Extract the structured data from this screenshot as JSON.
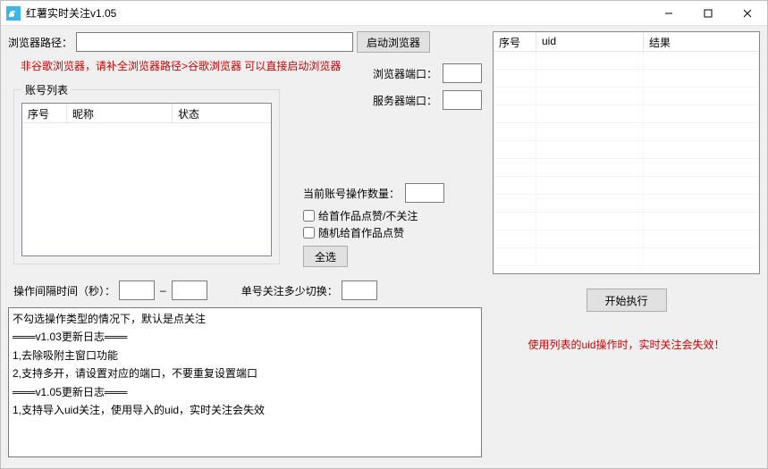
{
  "title": "红薯实时关注v1.05",
  "labels": {
    "browser_path": "浏览器路径：",
    "launch_browser": "启动浏览器",
    "note_red": "非谷歌浏览器，请补全浏览器路径>谷歌浏览器 可以直接启动浏览器",
    "browser_port": "浏览器端口：",
    "server_port": "服务器端口：",
    "account_list_legend": "账号列表",
    "col_seq": "序号",
    "col_nick": "昵称",
    "col_status": "状态",
    "current_account_ops": "当前账号操作数量：",
    "chk_like_unfollow": "给首作品点赞/不关注",
    "chk_random_like": "随机给首作品点赞",
    "select_all": "全选",
    "op_interval": "操作间隔时间（秒）：",
    "dash": "–",
    "single_switch": "单号关注多少切换：",
    "start_exec": "开始执行",
    "warn_red": "使用列表的uid操作时，实时关注会失效！",
    "right_col_seq": "序号",
    "right_col_uid": "uid",
    "right_col_result": "结果"
  },
  "values": {
    "browser_path": "",
    "browser_port": "",
    "server_port": "",
    "current_account_ops": "",
    "interval_min": "",
    "interval_max": "",
    "single_switch": ""
  },
  "log_text": "不勾选操作类型的情况下，默认是点关注\n═══v1.03更新日志═══\n1,去除吸附主窗口功能\n2,支持多开，请设置对应的端口，不要重复设置端口\n═══v1.05更新日志═══\n1,支持导入uid关注，使用导入的uid，实时关注会失效"
}
